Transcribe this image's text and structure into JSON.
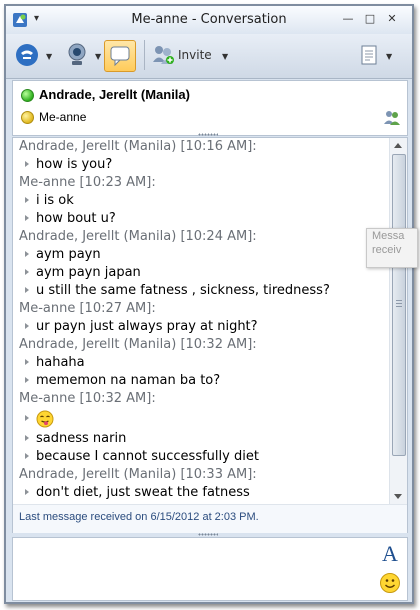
{
  "window": {
    "title": "Me-anne - Conversation",
    "sysmenu_glyph": "▾",
    "controls": {
      "minimize": "—",
      "maximize": "□",
      "close": "✕"
    }
  },
  "toolbar": {
    "buttons": [
      {
        "name": "phone-call",
        "icon": "phone-icon"
      },
      {
        "name": "video",
        "icon": "webcam-icon"
      },
      {
        "name": "im",
        "icon": "speech-bubble-icon",
        "active": true
      },
      {
        "name": "invite",
        "icon": "add-people-icon",
        "label": "Invite"
      },
      {
        "name": "share",
        "icon": "document-icon"
      }
    ],
    "invite_label": "Invite"
  },
  "participants": [
    {
      "name": "Andrade, Jerellt (Manila)",
      "status": "available",
      "color": "#2fb01e"
    },
    {
      "name": "Me-anne",
      "status": "away",
      "color": "#e0b81f"
    }
  ],
  "conversation": {
    "entries": [
      {
        "type": "header",
        "text": "Andrade, Jerellt (Manila) [10:16 AM]:"
      },
      {
        "type": "message",
        "text": "how is you?"
      },
      {
        "type": "header",
        "text": "Me-anne [10:23 AM]:"
      },
      {
        "type": "message",
        "text": "i is ok"
      },
      {
        "type": "message",
        "text": "how bout u?"
      },
      {
        "type": "header",
        "text": "Andrade, Jerellt (Manila) [10:24 AM]:"
      },
      {
        "type": "message",
        "text": "aym payn"
      },
      {
        "type": "message",
        "text": "aym payn japan"
      },
      {
        "type": "message",
        "text": "u still the same fatness , sickness, tiredness?"
      },
      {
        "type": "header",
        "text": "Me-anne [10:27 AM]:"
      },
      {
        "type": "message",
        "text": "ur payn just always pray at night?"
      },
      {
        "type": "header",
        "text": "Andrade, Jerellt (Manila) [10:32 AM]:"
      },
      {
        "type": "message",
        "text": "hahaha"
      },
      {
        "type": "message",
        "text": "mememon na naman ba to?"
      },
      {
        "type": "header",
        "text": "Me-anne [10:32 AM]:"
      },
      {
        "type": "emoticon",
        "icon": "tongue-out-emoticon"
      },
      {
        "type": "message",
        "text": "sadness narin"
      },
      {
        "type": "message",
        "text": "because I cannot successfully diet"
      },
      {
        "type": "header",
        "text": "Andrade, Jerellt (Manila) [10:33 AM]:"
      },
      {
        "type": "message",
        "text": "don't diet, just sweat the fatness"
      }
    ],
    "status": "Last message received on 6/15/2012 at 2:03 PM."
  },
  "compose": {
    "value": "",
    "font_button": "A",
    "emoticon_icon": "smiley-icon"
  },
  "tooltip": {
    "line1": "Messa",
    "line2": "receiv"
  },
  "colors": {
    "header_text": "#6a6f76",
    "status_text": "#2b4c7e",
    "active_button": "#ffcb5a"
  }
}
